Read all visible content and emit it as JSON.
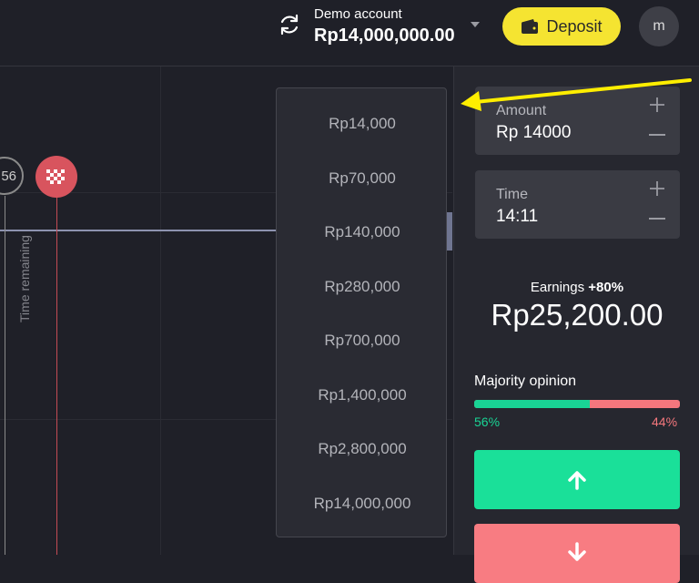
{
  "header": {
    "account_label": "Demo account",
    "balance": "Rp14,000,000.00",
    "deposit_label": "Deposit",
    "avatar_initial": "m"
  },
  "chart": {
    "timer_value": "56",
    "time_remaining_label": "Time remaining",
    "price_line_color": "#8d93b0",
    "expiry_color": "#d8545e"
  },
  "amount_dropdown": {
    "options": [
      "Rp14,000",
      "Rp70,000",
      "Rp140,000",
      "Rp280,000",
      "Rp700,000",
      "Rp1,400,000",
      "Rp2,800,000",
      "Rp14,000,000"
    ]
  },
  "trade_panel": {
    "amount": {
      "label": "Amount",
      "value": "Rp 14000"
    },
    "time": {
      "label": "Time",
      "value": "14:11"
    },
    "earnings_label": "Earnings",
    "earnings_pct": "+80%",
    "earnings_value": "Rp25,200.00",
    "majority_label": "Majority opinion",
    "majority_up_fraction": 0.56,
    "up_pct": "56%",
    "down_pct": "44%"
  },
  "colors": {
    "accent_yellow": "#f5e431",
    "up_green": "#1ae099",
    "down_red": "#f87c82"
  },
  "icons": {
    "refresh": "refresh-icon",
    "chevron": "chevron-down-icon",
    "wallet": "wallet-icon",
    "flag": "checkered-flag-icon",
    "plus": "plus-icon",
    "minus": "minus-icon",
    "up_arrow": "arrow-up-icon",
    "down_arrow": "arrow-down-icon"
  }
}
